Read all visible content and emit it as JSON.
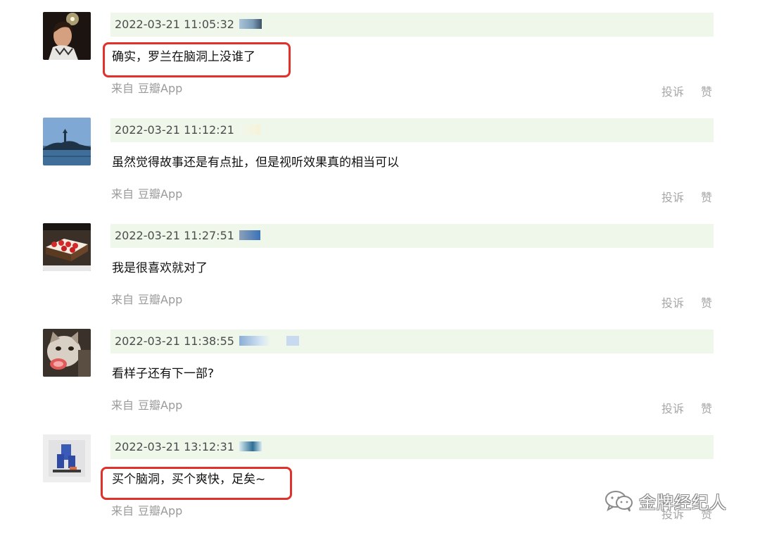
{
  "source_prefix": "来自",
  "source_app": "豆瓣App",
  "report_label": "投诉",
  "like_label": "赞",
  "highlight_color": "#e0312a",
  "meta_bg_color": "#eef7ea",
  "comments": [
    {
      "timestamp": "2022-03-21 11:05:32",
      "text": "确实，罗兰在脑洞上没谁了",
      "highlighted": true,
      "avatar": "woman-sparkler-avatar"
    },
    {
      "timestamp": "2022-03-21 11:12:21",
      "text": "虽然觉得故事还是有点扯，但是视听效果真的相当可以",
      "highlighted": false,
      "avatar": "lake-pagoda-avatar"
    },
    {
      "timestamp": "2022-03-21 11:27:51",
      "text": "我是很喜欢就对了",
      "highlighted": false,
      "avatar": "strawberry-cake-avatar"
    },
    {
      "timestamp": "2022-03-21 11:38:55",
      "text": "看样子还有下一部?",
      "highlighted": false,
      "avatar": "cat-avatar"
    },
    {
      "timestamp": "2022-03-21 13:12:31",
      "text": "买个脑洞，买个爽快，足矣~",
      "highlighted": true,
      "avatar": "blue-figure-avatar"
    }
  ],
  "watermark": {
    "text": "金牌经纪人",
    "icon": "wechat-icon"
  }
}
